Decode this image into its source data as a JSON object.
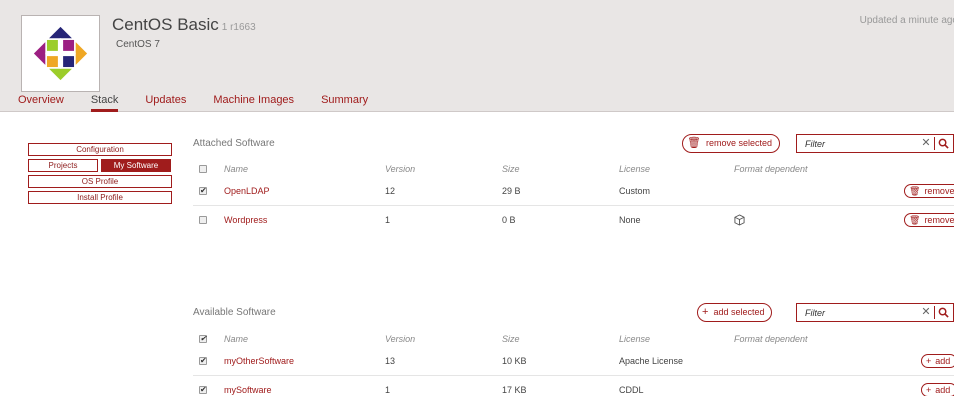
{
  "header": {
    "title": "CentOS Basic",
    "revision": "1 r1663",
    "subtitle": "CentOS 7",
    "updated": "Updated a minute ago"
  },
  "tabs": [
    {
      "label": "Overview"
    },
    {
      "label": "Stack",
      "active": true
    },
    {
      "label": "Updates"
    },
    {
      "label": "Machine Images"
    },
    {
      "label": "Summary"
    }
  ],
  "nav": {
    "configuration": "Configuration",
    "projects": "Projects",
    "my_software": "My Software",
    "os_profile": "OS Profile",
    "install_profile": "Install Profile"
  },
  "columns": {
    "name": "Name",
    "version": "Version",
    "size": "Size",
    "license": "License",
    "format": "Format dependent"
  },
  "attached": {
    "title": "Attached Software",
    "action_label": "remove selected",
    "action_icon": "trash-icon",
    "filter_placeholder": "Filter",
    "row_action": "remove",
    "rows": [
      {
        "checked": true,
        "name": "OpenLDAP",
        "version": "12",
        "size": "29 B",
        "license": "Custom",
        "format_icon": ""
      },
      {
        "checked": false,
        "name": "Wordpress",
        "version": "1",
        "size": "0 B",
        "license": "None",
        "format_icon": "package-icon"
      }
    ]
  },
  "available": {
    "title": "Available Software",
    "action_label": "add selected",
    "action_icon": "plus-icon",
    "filter_placeholder": "Filter",
    "row_action": "add",
    "rows": [
      {
        "checked": true,
        "name": "myOtherSoftware",
        "version": "13",
        "size": "10 KB",
        "license": "Apache License"
      },
      {
        "checked": true,
        "name": "mySoftware",
        "version": "1",
        "size": "17 KB",
        "license": "CDDL"
      }
    ]
  },
  "colors": {
    "accent": "#a01c1c",
    "header_bg": "#e9e6e5"
  }
}
